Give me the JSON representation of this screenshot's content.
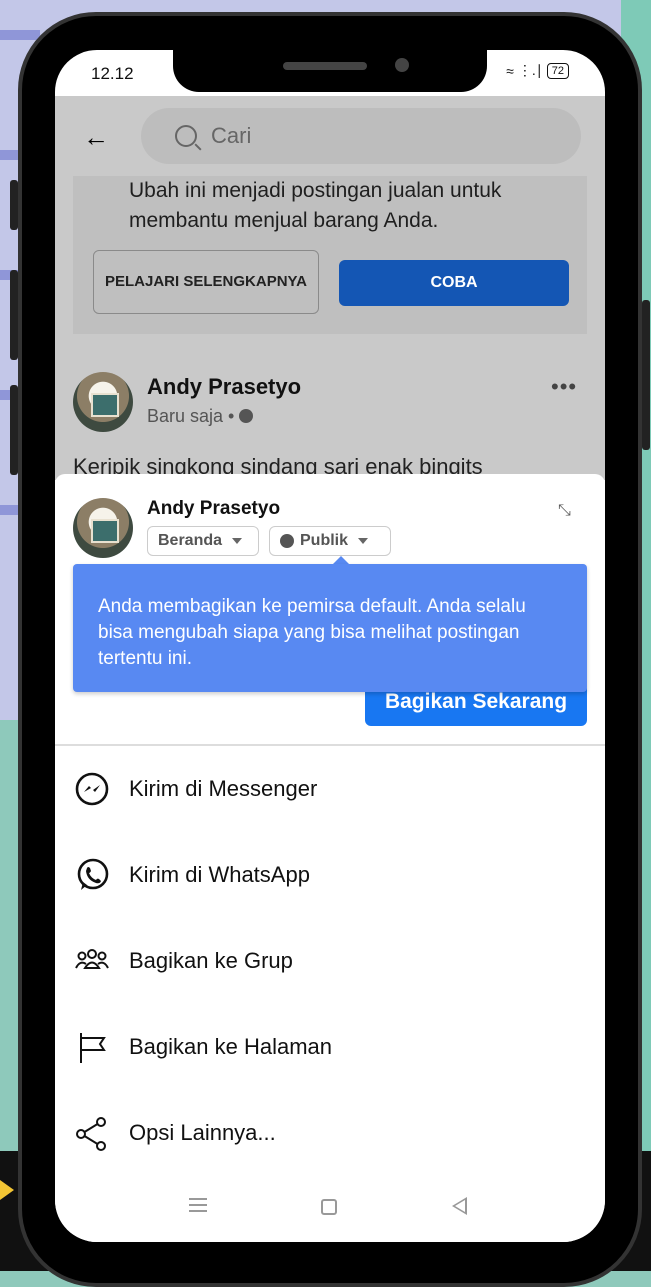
{
  "status_bar": {
    "time": "12.12",
    "signal": "⋮.∣",
    "wifi": "≈",
    "battery": "72"
  },
  "header": {
    "back_icon": "←",
    "search_placeholder": "Cari"
  },
  "promo": {
    "text": "Ubah ini menjadi postingan jualan untuk membantu menjual barang Anda.",
    "learn_more_label": "PELAJARI SELENGKAPNYA",
    "try_label": "COBA"
  },
  "post": {
    "author": "Andy Prasetyo",
    "meta": "Baru saja •",
    "more": "•••",
    "text": "Keripik singkong sindang sari enak bingits"
  },
  "share_sheet": {
    "author": "Andy Prasetyo",
    "destination_label": "Beranda",
    "audience_label": "Publik",
    "expand_icon": "⤡",
    "tooltip_text": "Anda membagikan ke pemirsa default. Anda selalu bisa mengubah siapa yang bisa melihat postingan tertentu ini.",
    "share_now_label": "Bagikan Sekarang"
  },
  "menu": [
    {
      "label": "Kirim di Messenger",
      "icon": "messenger-icon"
    },
    {
      "label": "Kirim di WhatsApp",
      "icon": "whatsapp-icon"
    },
    {
      "label": "Bagikan ke Grup",
      "icon": "group-icon"
    },
    {
      "label": "Bagikan ke Halaman",
      "icon": "page-flag-icon"
    },
    {
      "label": "Opsi Lainnya...",
      "icon": "share-icon"
    }
  ],
  "colors": {
    "primary": "#1877f2",
    "tooltip": "#5889f2",
    "coba": "#1456b4"
  }
}
